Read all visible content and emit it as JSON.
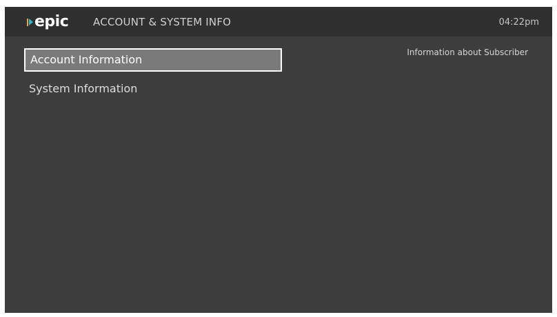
{
  "header": {
    "logo_text": "epic",
    "logo_colors": {
      "bar": "#f2a13b",
      "play": "#2fb4c9"
    },
    "title": "ACCOUNT & SYSTEM INFO",
    "time": "04:22pm"
  },
  "menu": {
    "items": [
      {
        "label": "Account Information",
        "selected": true
      },
      {
        "label": "System Information",
        "selected": false
      }
    ]
  },
  "description": "Information about Subscriber",
  "colors": {
    "background": "#3d3d3d",
    "header_bg": "#2f2f2f",
    "selected_bg": "#7a7a7a",
    "selected_border": "#ffffff"
  }
}
